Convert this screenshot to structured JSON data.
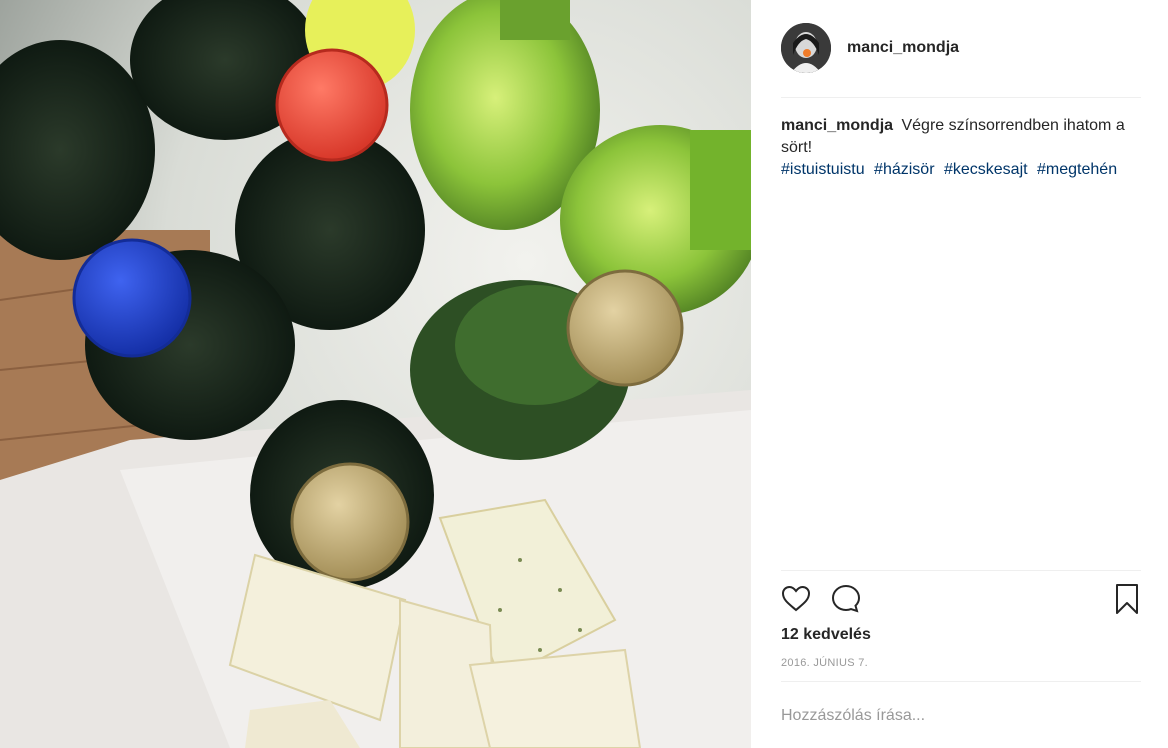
{
  "post": {
    "username": "manci_mondja",
    "caption_user": "manci_mondja",
    "caption_text": "Végre színsorrendben ihatom a sört!",
    "hashtags": [
      "#istuistuistu",
      "#házisör",
      "#kecskesajt",
      "#megtehén"
    ],
    "likes": "12 kedvelés",
    "date": "2016. JÚNIUS 7."
  },
  "comment": {
    "placeholder": "Hozzászólás írása..."
  },
  "icons": {
    "like": "heart-icon",
    "comment": "speech-bubble-icon",
    "save": "bookmark-icon"
  },
  "colors": {
    "hashtag": "#003569",
    "muted": "#999999",
    "text": "#262626",
    "cap_red": "#ee4b3e",
    "cap_blue": "#1d3fc9",
    "cap_gold": "#c9b27a"
  }
}
